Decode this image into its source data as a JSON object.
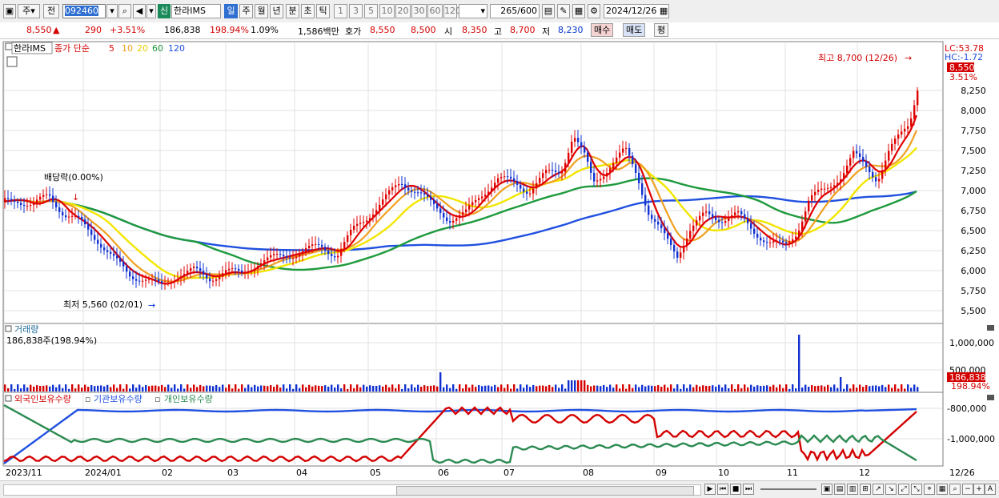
{
  "toolbar": {
    "period_label": "주",
    "prev_label": "전",
    "code": "092460",
    "mode_badge": "신",
    "stock_name": "한라IMS",
    "intervals": [
      "일",
      "주",
      "월",
      "년",
      "분",
      "초",
      "틱"
    ],
    "active_interval": "일",
    "numbers": [
      "1",
      "3",
      "5",
      "10",
      "20",
      "30",
      "60",
      "120"
    ],
    "count": "265",
    "count_total": "/600",
    "date": "2024/12/26"
  },
  "info": {
    "price": "8,550",
    "arrow": "▲",
    "change": "290",
    "change_pct": "+3.51%",
    "volume": "186,838",
    "volume_pct": "198.94%",
    "turnover_pct": "1.09%",
    "amount": "1,586백만",
    "quote_label": "호가",
    "ask": "8,550",
    "bid": "8,500",
    "open_label": "시",
    "open": "8,350",
    "high_label": "고",
    "high": "8,700",
    "low_label": "저",
    "low": "8,230",
    "buy_label": "매수",
    "sell_label": "매도",
    "eval_label": "평"
  },
  "price_panel": {
    "name_tag": "한라IMS",
    "legend_type": "종가 단순",
    "ma_periods": [
      "5",
      "10",
      "20",
      "60",
      "120"
    ],
    "lc": "LC:53.78",
    "hc": "HC:-1.72",
    "current_tag": "8,550",
    "current_pct": "3.51%",
    "high_annotation": "최고 8,700 (12/26)",
    "low_annotation": "최저 5,560 (02/01)",
    "dividend_annotation": "배당락(0.00%)",
    "y_labels": [
      "8,250",
      "8,000",
      "7,750",
      "7,500",
      "7,250",
      "7,000",
      "6,750",
      "6,500",
      "6,250",
      "6,000",
      "5,750",
      "5,500"
    ],
    "colors": {
      "ma5": "#e00000",
      "ma10": "#f0a020",
      "ma20": "#f2e600",
      "ma60": "#1e9a3c",
      "ma120": "#2050e0",
      "candle_up": "#e00000",
      "candle_down": "#1030d0"
    }
  },
  "volume_panel": {
    "title": "거래량",
    "value_line": "186,838주(198.94%)",
    "y_labels": [
      "1,000,000",
      "500,000"
    ],
    "last_value": "186,838",
    "last_pct": "198.94%"
  },
  "holdings_panel": {
    "labels": [
      "외국인보유수량",
      "기관보유수량",
      "개인보유수량"
    ],
    "y_labels": [
      "-800,000",
      "-1,000,000"
    ],
    "colors": {
      "foreign": "#d40000",
      "institution": "#2050e0",
      "individual": "#2a8a50"
    }
  },
  "x_axis": {
    "labels": [
      "2023/11",
      "2024/01",
      "02",
      "03",
      "04",
      "05",
      "06",
      "07",
      "08",
      "09",
      "10",
      "11",
      "12"
    ],
    "end_label": "12/26"
  }
}
